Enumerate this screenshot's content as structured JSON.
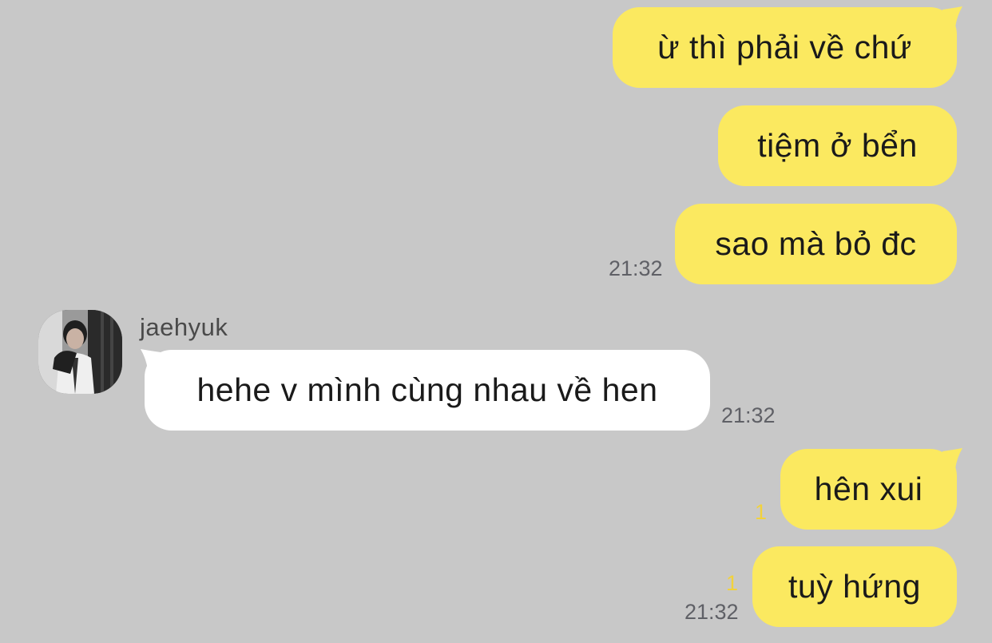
{
  "chat": {
    "contact": {
      "name": "jaehyuk",
      "avatar_icon": "profile-photo-icon"
    },
    "colors": {
      "background": "#c8c8c8",
      "outgoing_bubble": "#fbe960",
      "incoming_bubble": "#ffffff",
      "unread_count": "#f2d23c",
      "timestamp": "#5f6066"
    },
    "messages": [
      {
        "sender": "me",
        "text": "ừ thì phải về chứ"
      },
      {
        "sender": "me",
        "text": "tiệm ở bển"
      },
      {
        "sender": "me",
        "text": "sao mà bỏ đc",
        "time": "21:32"
      },
      {
        "sender": "jaehyuk",
        "text": "hehe v mình cùng nhau về hen",
        "time": "21:32"
      },
      {
        "sender": "me",
        "text": "hên xui",
        "unread": "1"
      },
      {
        "sender": "me",
        "text": "tuỳ hứng",
        "unread": "1",
        "time": "21:32"
      }
    ]
  }
}
